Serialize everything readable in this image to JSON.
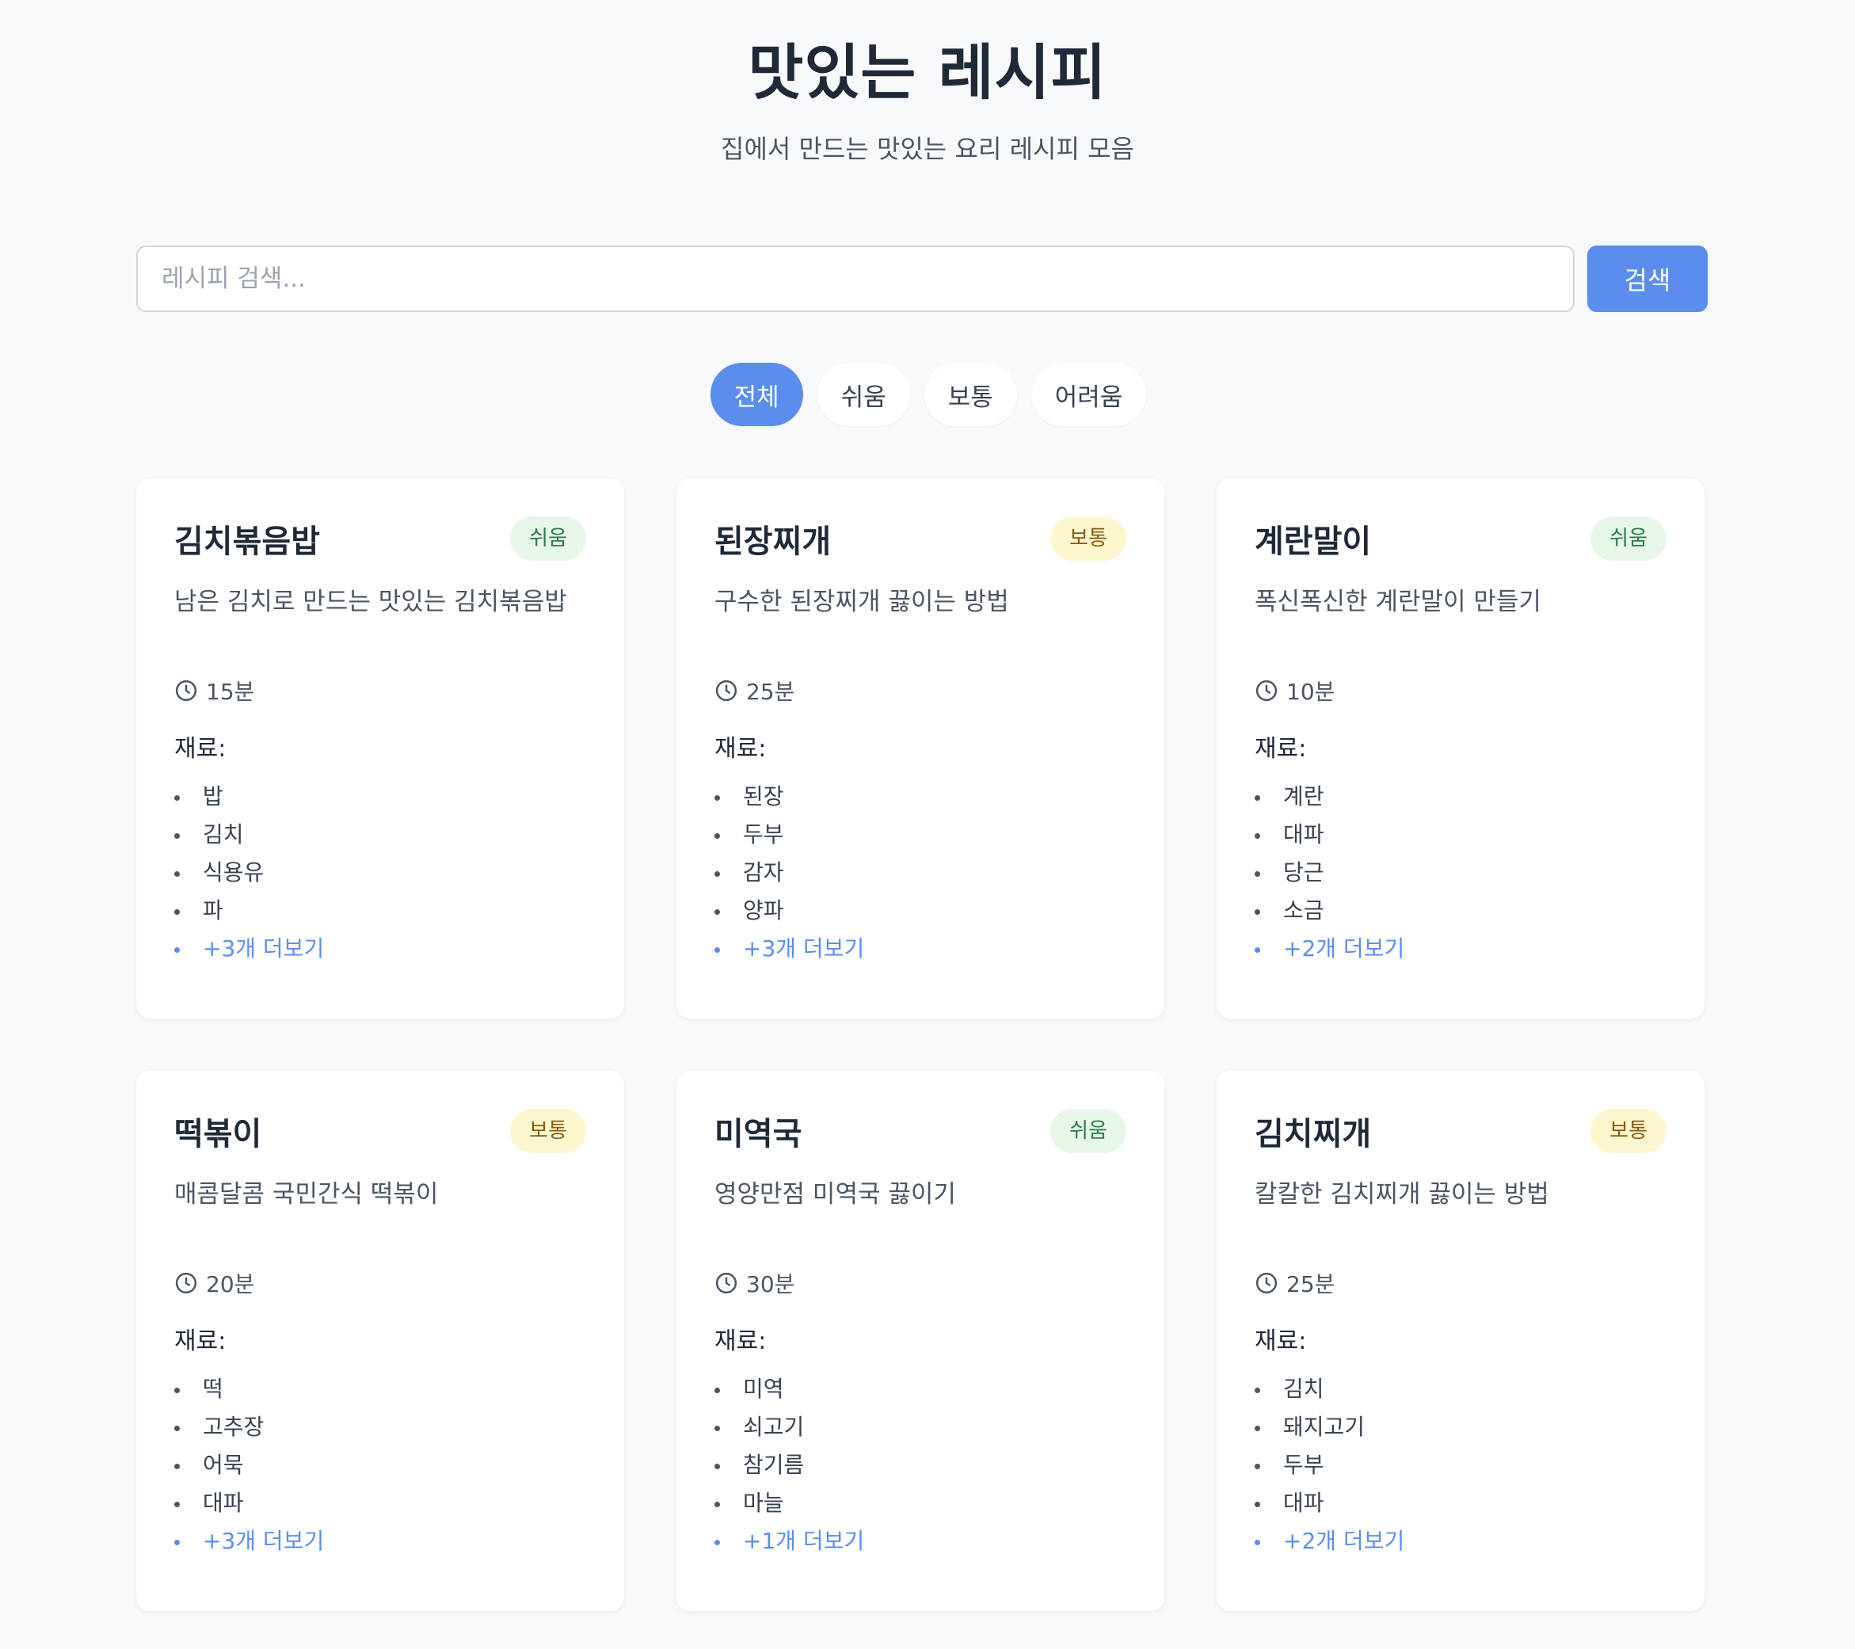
{
  "header": {
    "title": "맛있는 레시피",
    "subtitle": "집에서 만드는 맛있는 요리 레시피 모음"
  },
  "search": {
    "placeholder": "레시피 검색...",
    "button_label": "검색"
  },
  "filters": {
    "all": "전체",
    "easy": "쉬움",
    "medium": "보통",
    "hard": "어려움",
    "active": "all"
  },
  "recipes": [
    {
      "title": "김치볶음밥",
      "difficulty": "쉬움",
      "description": "남은 김치로 만드는 맛있는 김치볶음밥",
      "time": "15분",
      "ingredients_label": "재료:",
      "ingredients": [
        "밥",
        "김치",
        "식용유",
        "파"
      ],
      "more": "+3개 더보기"
    },
    {
      "title": "된장찌개",
      "difficulty": "보통",
      "description": "구수한 된장찌개 끓이는 방법",
      "time": "25분",
      "ingredients_label": "재료:",
      "ingredients": [
        "된장",
        "두부",
        "감자",
        "양파"
      ],
      "more": "+3개 더보기"
    },
    {
      "title": "계란말이",
      "difficulty": "쉬움",
      "description": "폭신폭신한 계란말이 만들기",
      "time": "10분",
      "ingredients_label": "재료:",
      "ingredients": [
        "계란",
        "대파",
        "당근",
        "소금"
      ],
      "more": "+2개 더보기"
    },
    {
      "title": "떡볶이",
      "difficulty": "보통",
      "description": "매콤달콤 국민간식 떡볶이",
      "time": "20분",
      "ingredients_label": "재료:",
      "ingredients": [
        "떡",
        "고추장",
        "어묵",
        "대파"
      ],
      "more": "+3개 더보기"
    },
    {
      "title": "미역국",
      "difficulty": "쉬움",
      "description": "영양만점 미역국 끓이기",
      "time": "30분",
      "ingredients_label": "재료:",
      "ingredients": [
        "미역",
        "쇠고기",
        "참기름",
        "마늘"
      ],
      "more": "+1개 더보기"
    },
    {
      "title": "김치찌개",
      "difficulty": "보통",
      "description": "칼칼한 김치찌개 끓이는 방법",
      "time": "25분",
      "ingredients_label": "재료:",
      "ingredients": [
        "김치",
        "돼지고기",
        "두부",
        "대파"
      ],
      "more": "+2개 더보기"
    }
  ],
  "colors": {
    "accent": "#5b8def",
    "background": "#f8f9fb",
    "badge_easy_bg": "#e6f7ea",
    "badge_easy_text": "#2f7a48",
    "badge_medium_bg": "#fdf6cf",
    "badge_medium_text": "#8a5a13"
  },
  "icons": {
    "time": "clock-icon"
  }
}
